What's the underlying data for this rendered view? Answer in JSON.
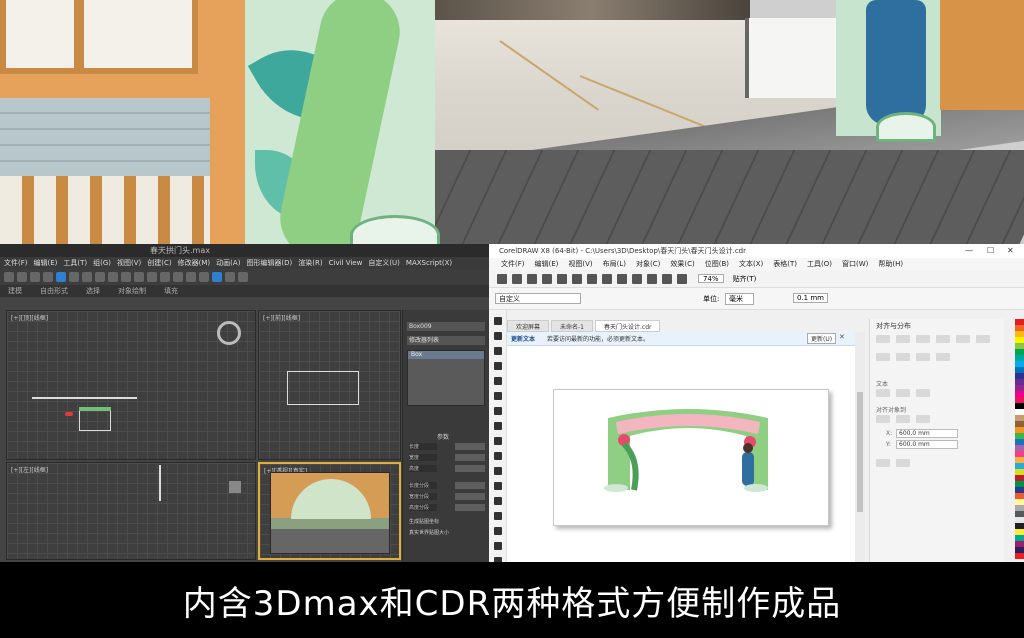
{
  "caption": {
    "text": "内含3Dmax和CDR两种格式方便制作成品"
  },
  "max": {
    "title": "春天拱门头.max",
    "search_placeholder": "输入关键字或短语",
    "menu": [
      "文件(F)",
      "编辑(E)",
      "工具(T)",
      "组(G)",
      "视图(V)",
      "创建(C)",
      "修改器(M)",
      "动画(A)",
      "图形编辑器(D)",
      "渲染(R)",
      "Civil View",
      "自定义(U)",
      "MAXScript(X)",
      "帮助(H)"
    ],
    "tabs": [
      "建模",
      "自由形式",
      "选择",
      "对象绘制",
      "填充"
    ],
    "viewport_labels": [
      "[+][顶][线框]",
      "[+][前][线框]",
      "[+][左][线框]",
      "[+][透视][真实]"
    ],
    "command_panel": {
      "object_name": "Box009",
      "modifier": "修改器列表",
      "item": "Box",
      "params_title": "参数",
      "fields": [
        "长度",
        "宽度",
        "高度",
        "长度分段",
        "宽度分段",
        "高度分段"
      ],
      "options": [
        "生成贴图坐标",
        "真实世界贴图大小"
      ]
    }
  },
  "cdr": {
    "title": "CorelDRAW X8 (64-Bit) - C:\\Users\\3D\\Desktop\\春天门头\\春天门头设计.cdr",
    "menu": [
      "文件(F)",
      "编辑(E)",
      "视图(V)",
      "布局(L)",
      "对象(C)",
      "效果(C)",
      "位图(B)",
      "文本(X)",
      "表格(T)",
      "工具(O)",
      "窗口(W)",
      "帮助(H)"
    ],
    "preset": "自定义",
    "zoom": "74%",
    "units_label": "单位:",
    "units": "毫米",
    "nudge": "0.1 mm",
    "snap_label": "贴齐(T)",
    "tabs": [
      "欢迎屏幕",
      "未命名-1",
      "春天门头设计.cdr"
    ],
    "notice": {
      "title": "更新文本",
      "text": "若要访问最新的功能，必须更新文本。",
      "button": "更新(U)"
    },
    "docker": {
      "title": "对齐与分布",
      "section_text": "文本",
      "section_align": "对齐对象到",
      "x_value": "600.0 mm",
      "y_value": "600.0 mm"
    },
    "colors": [
      "#e31c23",
      "#f26522",
      "#fdb913",
      "#fff200",
      "#8dc63f",
      "#00a651",
      "#00a99d",
      "#00aeef",
      "#0072bc",
      "#2e3192",
      "#662d91",
      "#92278f",
      "#ec008c",
      "#ed145b",
      "#000000",
      "#ffffff",
      "#c69c6d",
      "#8c6239",
      "#f7941d",
      "#39b54a",
      "#1b75bc",
      "#a864a8",
      "#ee3f8b",
      "#fbb040",
      "#27aae1",
      "#d7df23",
      "#be1e2d",
      "#009444",
      "#2b3990",
      "#f15a29",
      "#fff799",
      "#a7a9ac",
      "#58595b",
      "#e6e7e8",
      "#231f20",
      "#f9ed32",
      "#00a79d",
      "#9e1f63",
      "#262262",
      "#ed1c24"
    ]
  }
}
